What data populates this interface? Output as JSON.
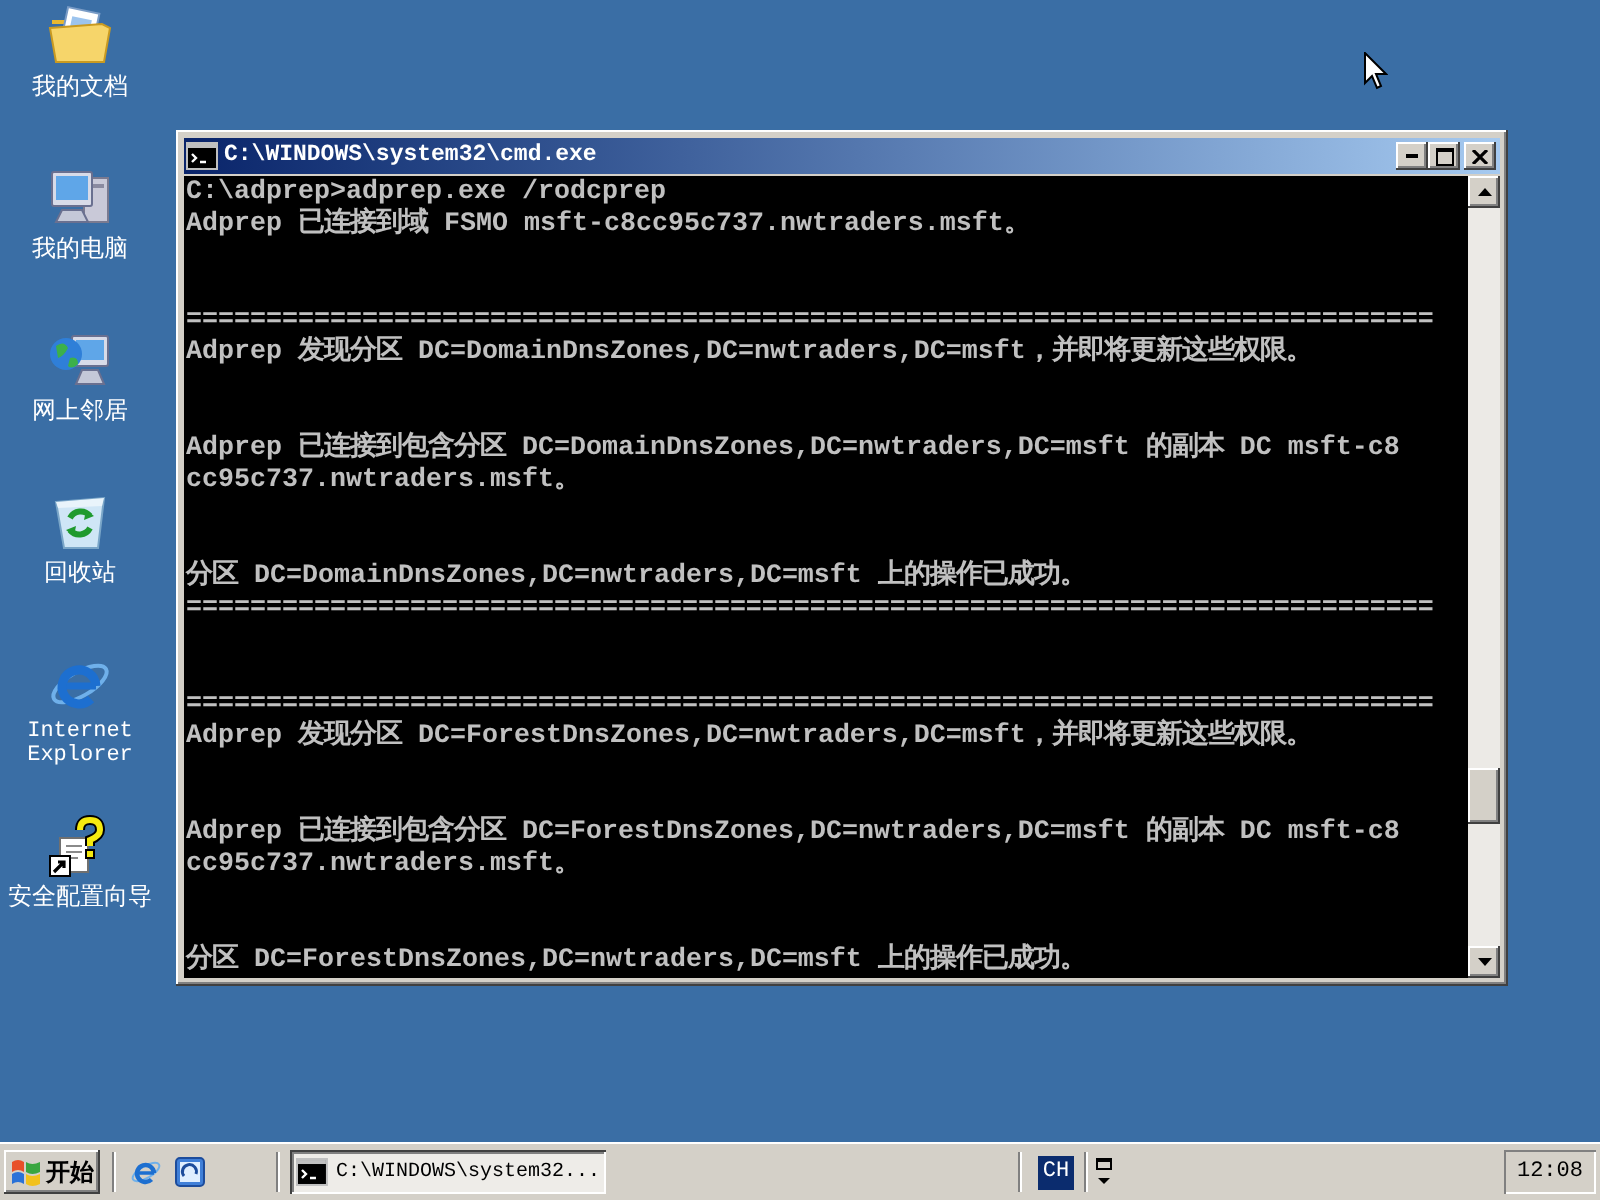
{
  "desktop_icons": [
    {
      "label": "我的文档",
      "kind": "documents"
    },
    {
      "label": "我的电脑",
      "kind": "computer"
    },
    {
      "label": "网上邻居",
      "kind": "network"
    },
    {
      "label": "回收站",
      "kind": "recycle_bin"
    },
    {
      "label": "Internet Explorer",
      "kind": "browser"
    },
    {
      "label": "安全配置向导",
      "kind": "wizard"
    }
  ],
  "window": {
    "title": "C:\\WINDOWS\\system32\\cmd.exe",
    "console_blocks": [
      {
        "lines": [
          "C:\\adprep>adprep.exe /rodcprep",
          "Adprep 已连接到域 FSMO msft-c8cc95c737.nwtraders.msft。"
        ]
      },
      {
        "lines": [
          "==============================================================================",
          "Adprep 发现分区 DC=DomainDnsZones,DC=nwtraders,DC=msft，并即将更新这些权限。"
        ]
      },
      {
        "lines": [
          "Adprep 已连接到包含分区 DC=DomainDnsZones,DC=nwtraders,DC=msft 的副本 DC msft-c8",
          "cc95c737.nwtraders.msft。"
        ]
      },
      {
        "lines": [
          "分区 DC=DomainDnsZones,DC=nwtraders,DC=msft 上的操作已成功。",
          "=============================================================================="
        ]
      },
      {
        "lines": [
          "==============================================================================",
          "Adprep 发现分区 DC=ForestDnsZones,DC=nwtraders,DC=msft，并即将更新这些权限。"
        ]
      },
      {
        "lines": [
          "Adprep 已连接到包含分区 DC=ForestDnsZones,DC=nwtraders,DC=msft 的副本 DC msft-c8",
          "cc95c737.nwtraders.msft。"
        ]
      },
      {
        "lines": [
          "分区 DC=ForestDnsZones,DC=nwtraders,DC=msft 上的操作已成功。"
        ]
      }
    ]
  },
  "taskbar": {
    "start_button": {
      "label": "开始"
    },
    "tasks": [
      {
        "label": "C:\\WINDOWS\\system32...",
        "selected": true
      }
    ],
    "language": "CH",
    "clock": "12:08"
  }
}
